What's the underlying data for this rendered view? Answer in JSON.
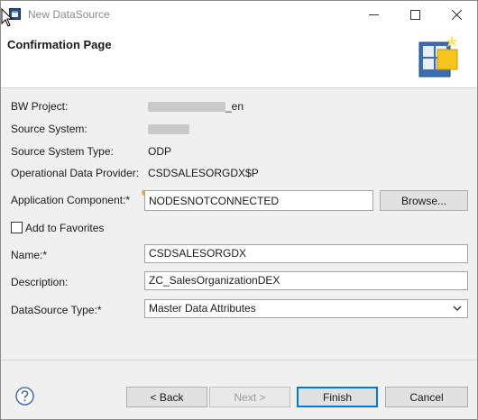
{
  "window": {
    "title": "New DataSource"
  },
  "header": {
    "page_title": "Confirmation Page"
  },
  "fields": {
    "bw_project": {
      "label": "BW Project:",
      "value_suffix": "_en"
    },
    "source_system": {
      "label": "Source System:"
    },
    "source_system_type": {
      "label": "Source System Type:",
      "value": "ODP"
    },
    "operational_data_provider": {
      "label": "Operational Data Provider:",
      "value": "CSDSALESORGDX$P"
    },
    "application_component": {
      "label": "Application Component:*",
      "value": "NODESNOTCONNECTED",
      "browse_label": "Browse..."
    },
    "add_to_favorites": {
      "label": "Add to Favorites",
      "checked": false
    },
    "name": {
      "label": "Name:*",
      "value": "CSDSALESORGDX"
    },
    "description": {
      "label": "Description:",
      "value": "ZC_SalesOrganizationDEX"
    },
    "datasource_type": {
      "label": "DataSource Type:*",
      "value": "Master Data Attributes"
    }
  },
  "footer": {
    "back_label": "< Back",
    "next_label": "Next >",
    "finish_label": "Finish",
    "cancel_label": "Cancel"
  },
  "colors": {
    "accent": "#0078d7",
    "help_blue": "#4a6fa5"
  }
}
